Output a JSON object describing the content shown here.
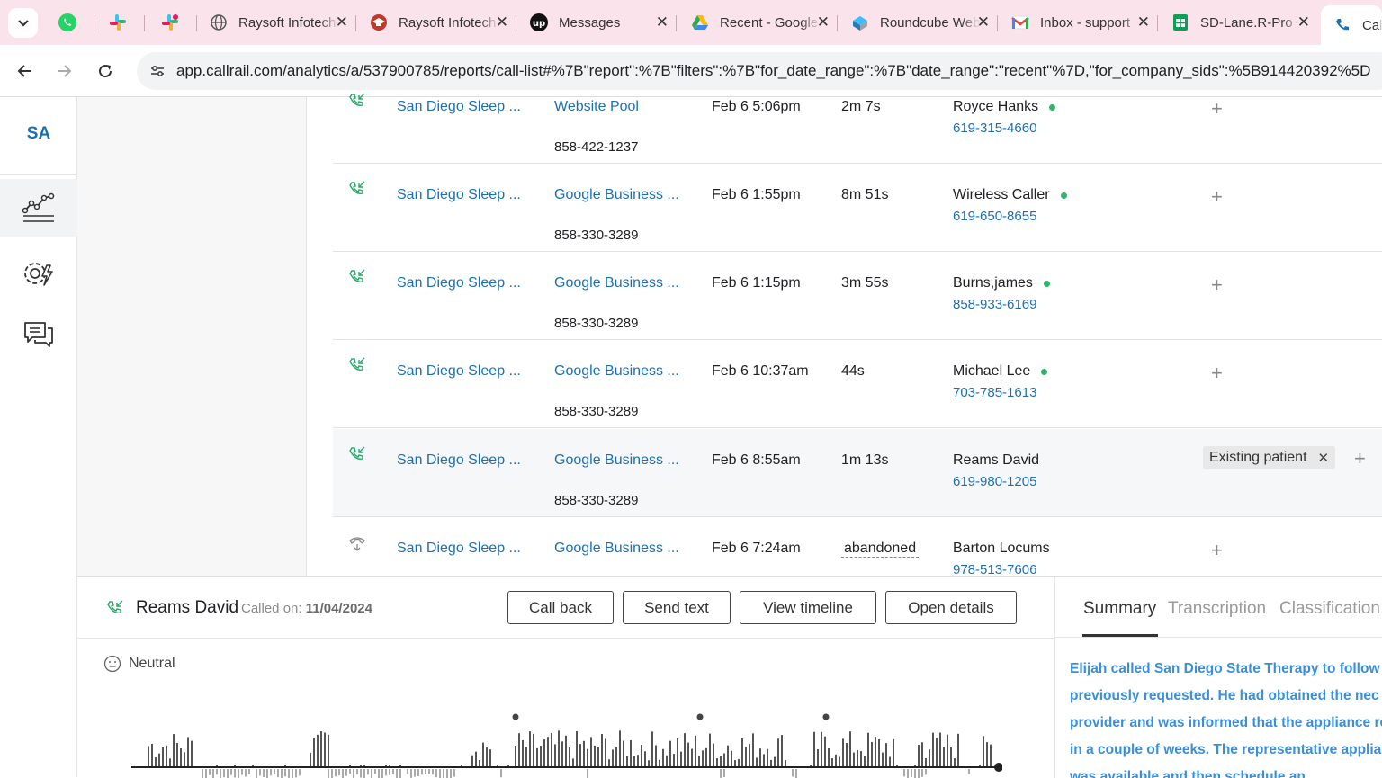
{
  "browser": {
    "tabs": [
      {
        "title": "Raysoft Infotech",
        "icon": "globe-icon"
      },
      {
        "title": "Raysoft Infotech",
        "icon": "graduation-cap-icon"
      },
      {
        "title": "Messages",
        "icon": "upwork-icon"
      },
      {
        "title": "Recent - Google Drive",
        "icon": "google-drive-icon"
      },
      {
        "title": "Roundcube Webmail",
        "icon": "roundcube-icon"
      },
      {
        "title": "Inbox - support",
        "icon": "gmail-icon"
      },
      {
        "title": "SD-Lane.R-Pro",
        "icon": "google-sheets-icon"
      },
      {
        "title": "Call",
        "icon": "callrail-icon"
      }
    ],
    "url": "app.callrail.com/analytics/a/537900785/reports/call-list#%7B\"report\":%7B\"filters\":%7B\"for_date_range\":%7B\"date_range\":\"recent\"%7D,\"for_company_sids\":%5B914420392%5D"
  },
  "app": {
    "brand": "SA",
    "nav": [
      "analytics-icon",
      "settings-icon",
      "conversations-icon"
    ]
  },
  "calls": [
    {
      "company": "San Diego Sleep ...",
      "source": "Website Pool",
      "tracking": "858-422-1237",
      "date": "Feb 6 5:06pm",
      "duration": "2m 7s",
      "caller": "Royce Hanks",
      "phone": "619-315-4660",
      "status": "answered",
      "new_caller": true
    },
    {
      "company": "San Diego Sleep ...",
      "source": "Google Business ...",
      "tracking": "858-330-3289",
      "date": "Feb 6 1:55pm",
      "duration": "8m 51s",
      "caller": "Wireless Caller",
      "phone": "619-650-8655",
      "status": "answered",
      "new_caller": true
    },
    {
      "company": "San Diego Sleep ...",
      "source": "Google Business ...",
      "tracking": "858-330-3289",
      "date": "Feb 6 1:15pm",
      "duration": "3m 55s",
      "caller": "Burns,james",
      "phone": "858-933-6169",
      "status": "answered",
      "new_caller": true
    },
    {
      "company": "San Diego Sleep ...",
      "source": "Google Business ...",
      "tracking": "858-330-3289",
      "date": "Feb 6 10:37am",
      "duration": "44s",
      "caller": "Michael Lee",
      "phone": "703-785-1613",
      "status": "answered",
      "new_caller": true
    },
    {
      "company": "San Diego Sleep ...",
      "source": "Google Business ...",
      "tracking": "858-330-3289",
      "date": "Feb 6 8:55am",
      "duration": "1m 13s",
      "caller": "Reams David",
      "phone": "619-980-1205",
      "status": "answered",
      "new_caller": false,
      "tag": "Existing patient"
    },
    {
      "company": "San Diego Sleep ...",
      "source": "Google Business ...",
      "tracking": "",
      "date": "Feb 6 7:24am",
      "duration": "abandoned",
      "caller": "Barton Locums",
      "phone": "978-513-7606",
      "status": "abandoned",
      "new_caller": false
    }
  ],
  "detail": {
    "caller": "Reams David",
    "called_on_label": "Called on:",
    "called_on": "11/04/2024",
    "buttons": {
      "call_back": "Call back",
      "send_text": "Send text",
      "view_timeline": "View timeline",
      "open_details": "Open details"
    },
    "sentiment": "Neutral",
    "tabs": {
      "summary": "Summary",
      "transcription": "Transcription",
      "classification": "Classification"
    },
    "summary_text": "Elijah called San Diego State Therapy to follow previously requested. He had obtained the nec provider and was informed that the appliance ready in a couple of weeks. The representative appliance was available and then schedule an"
  },
  "colors": {
    "link": "#1f6fb0",
    "green_dot": "#2fb46a",
    "summary_text": "#3a8fd8",
    "tabbar_bg": "#fbe3ec"
  }
}
